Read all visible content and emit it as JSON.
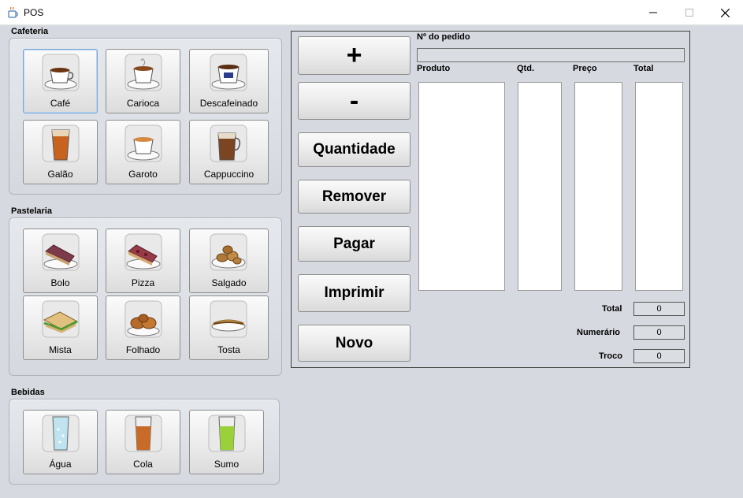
{
  "window": {
    "title": "POS",
    "icon": "java-cup-icon"
  },
  "cafeteria": {
    "title": "Cafeteria",
    "items": [
      {
        "label": "Café",
        "icon": "coffee-cup-icon"
      },
      {
        "label": "Carioca",
        "icon": "carioca-cup-icon"
      },
      {
        "label": "Descafeinado",
        "icon": "decaf-cup-icon"
      },
      {
        "label": "Galão",
        "icon": "galao-glass-icon"
      },
      {
        "label": "Garoto",
        "icon": "garoto-cup-icon"
      },
      {
        "label": "Cappuccino",
        "icon": "cappuccino-glass-icon"
      }
    ]
  },
  "pastelaria": {
    "title": "Pastelaria",
    "items": [
      {
        "label": "Bolo",
        "icon": "cake-slice-icon"
      },
      {
        "label": "Pizza",
        "icon": "pizza-slice-icon"
      },
      {
        "label": "Salgado",
        "icon": "savory-snacks-icon"
      },
      {
        "label": "Mista",
        "icon": "sandwich-icon"
      },
      {
        "label": "Folhado",
        "icon": "croissant-icon"
      },
      {
        "label": "Tosta",
        "icon": "toast-icon"
      }
    ]
  },
  "bebidas": {
    "title": "Bebidas",
    "items": [
      {
        "label": "Água",
        "icon": "water-glass-icon"
      },
      {
        "label": "Cola",
        "icon": "cola-glass-icon"
      },
      {
        "label": "Sumo",
        "icon": "juice-glass-icon"
      }
    ]
  },
  "actions": {
    "plus": "+",
    "minus": "-",
    "quantity": "Quantidade",
    "remove": "Remover",
    "pay": "Pagar",
    "print": "Imprimir",
    "new": "Novo"
  },
  "order": {
    "number_label": "Nº do pedido",
    "number_value": "",
    "columns": [
      "Produto",
      "Qtd.",
      "Preço",
      "Total"
    ],
    "total_label": "Total",
    "total_value": "0",
    "cash_label": "Numerário",
    "cash_value": "0",
    "change_label": "Troco",
    "change_value": "0"
  }
}
